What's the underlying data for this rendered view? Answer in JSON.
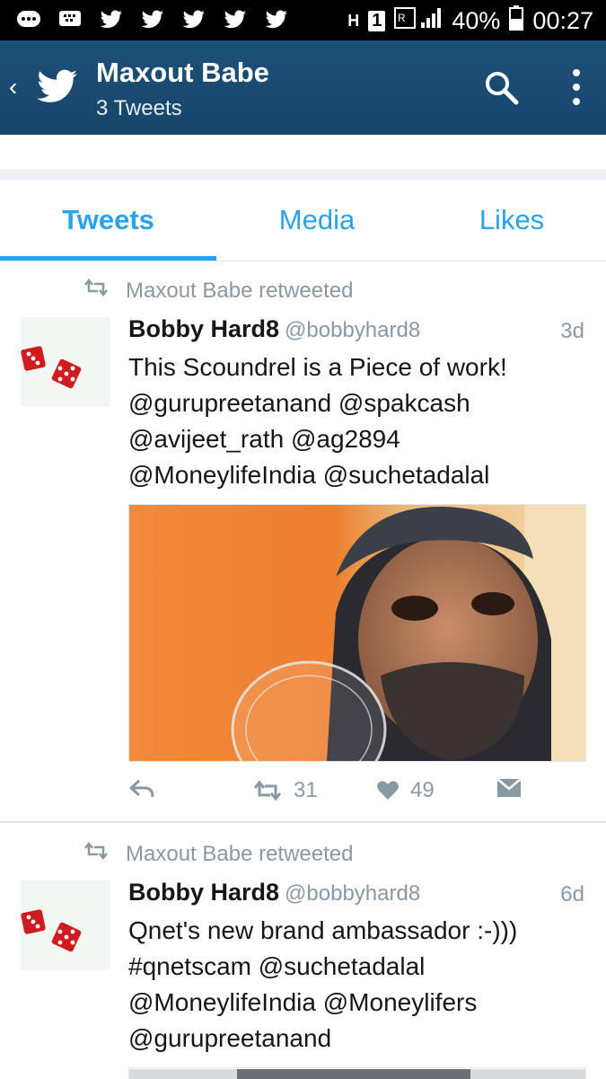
{
  "status_bar": {
    "notification_icons": [
      "chat-icon",
      "bbm-icon",
      "twitter-icon",
      "twitter-icon",
      "twitter-icon",
      "twitter-icon",
      "twitter-icon"
    ],
    "network": "H",
    "sim": "1",
    "battery": "40%",
    "time": "00:27"
  },
  "app_bar": {
    "title": "Maxout Babe",
    "subtitle": "3 Tweets",
    "back_label": "‹"
  },
  "tabs": [
    {
      "label": "Tweets",
      "active": true
    },
    {
      "label": "Media",
      "active": false
    },
    {
      "label": "Likes",
      "active": false
    }
  ],
  "tweets": [
    {
      "retweeted_by": "Maxout Babe retweeted",
      "name": "Bobby Hard8",
      "handle": "@bobbyhard8",
      "time": "3d",
      "text_lines": [
        "This Scoundrel is a Piece of work!",
        "@gurupreetanand @spakcash",
        "@avijeet_rath @ag2894",
        "@MoneylifeIndia @suchetadalal"
      ],
      "retweets": "31",
      "likes": "49"
    },
    {
      "retweeted_by": "Maxout Babe retweeted",
      "name": "Bobby Hard8",
      "handle": "@bobbyhard8",
      "time": "6d",
      "text_lines": [
        "Qnet's new brand ambassador :-)))",
        "#qnetscam @suchetadalal",
        "@MoneylifeIndia @Moneylifers",
        "@gurupreetanand"
      ]
    }
  ],
  "colors": {
    "app_bar": "#1b4f72",
    "accent": "#2aa3ef",
    "muted": "#8899a6"
  }
}
